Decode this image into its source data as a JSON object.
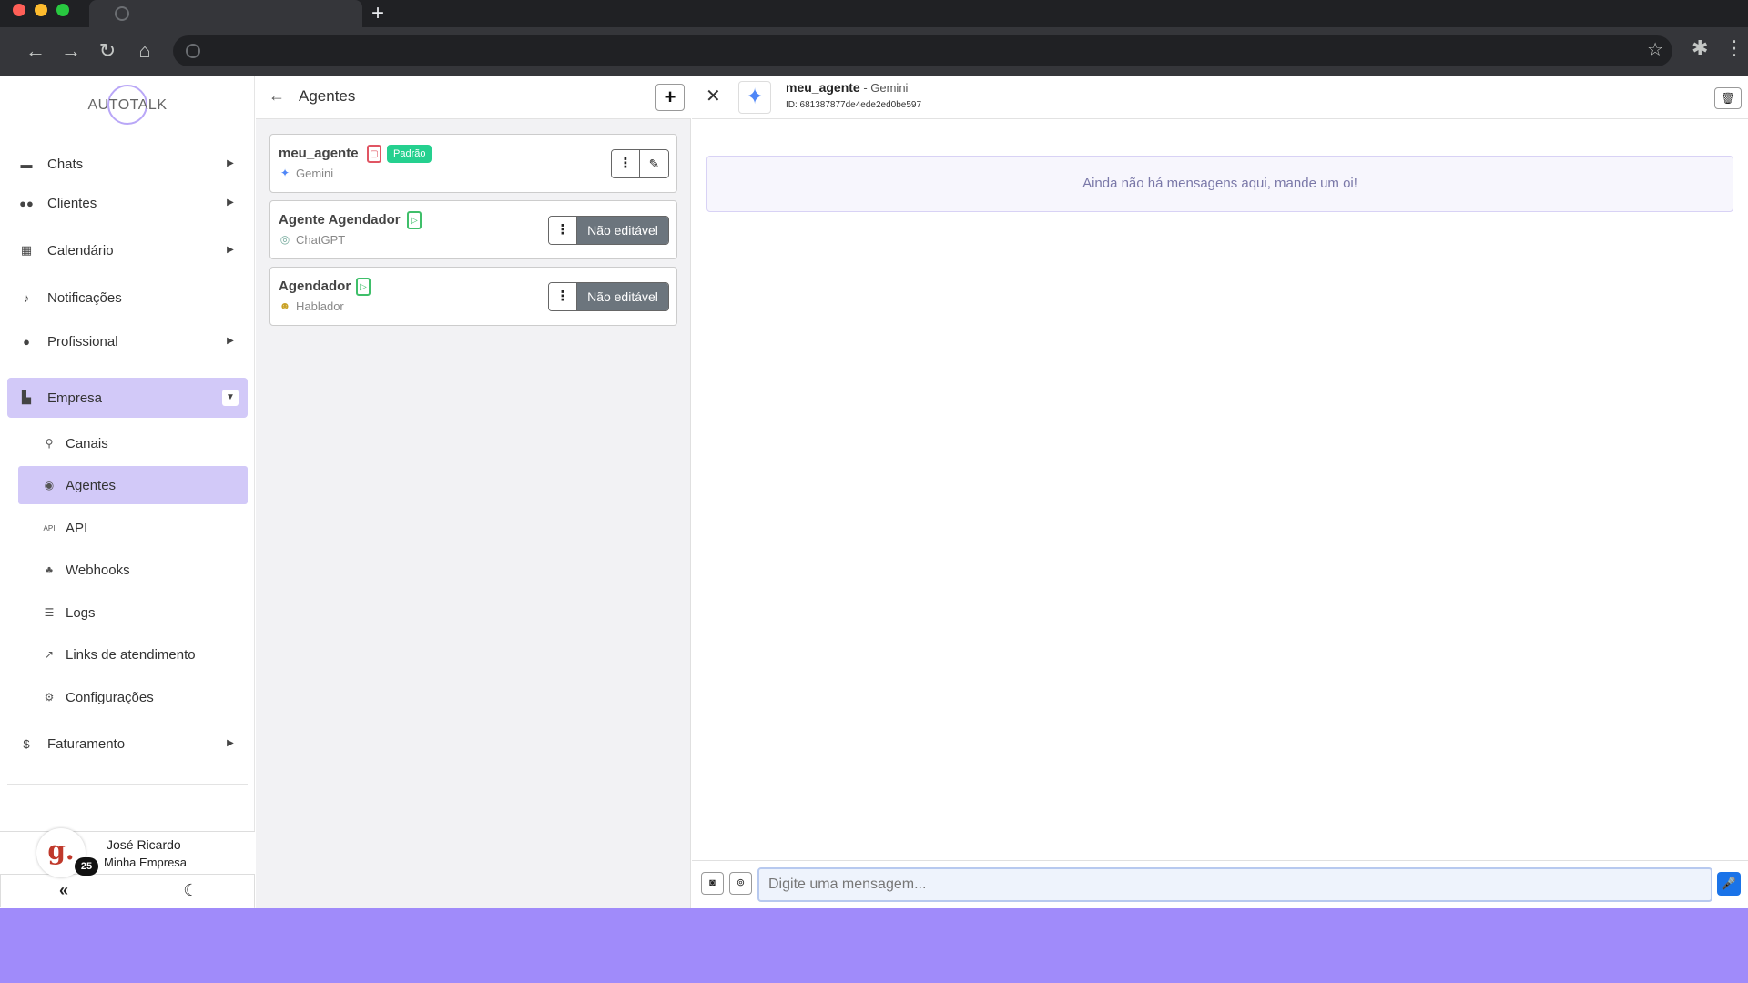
{
  "browser": {
    "new_tab_icon": "plus-icon",
    "nav_icons": [
      "back-arrow-icon",
      "forward-arrow-icon",
      "reload-icon",
      "home-icon"
    ]
  },
  "sidebar": {
    "logo_text": "AUTOTALK",
    "items": [
      {
        "label": "Chats",
        "icon": "comment-icon"
      },
      {
        "label": "Clientes",
        "icon": "users-icon"
      },
      {
        "label": "Calendário",
        "icon": "calendar-icon"
      },
      {
        "label": "Notificações",
        "icon": "bell-icon"
      },
      {
        "label": "Profissional",
        "icon": "user-gear-icon"
      },
      {
        "label": "Empresa",
        "icon": "building-icon"
      },
      {
        "label": "Faturamento",
        "icon": "dollar-icon"
      }
    ],
    "sub_items": [
      {
        "label": "Canais",
        "icon": "satellite-icon"
      },
      {
        "label": "Agentes",
        "icon": "robot-icon"
      },
      {
        "label": "API",
        "icon": "api-icon"
      },
      {
        "label": "Webhooks",
        "icon": "webhook-icon"
      },
      {
        "label": "Logs",
        "icon": "list-icon"
      },
      {
        "label": "Links de atendimento",
        "icon": "external-link-icon"
      },
      {
        "label": "Configurações",
        "icon": "gear-icon"
      }
    ],
    "user": {
      "name": "José Ricardo",
      "company": "Minha Empresa",
      "avatar_letter": "g.",
      "badge_count": "25"
    }
  },
  "agents": {
    "title": "Agentes",
    "list": [
      {
        "name": "meu_agente",
        "provider": "Gemini",
        "tag": "Padrão",
        "action": "Editar"
      },
      {
        "name": "Agente Agendador",
        "provider": "ChatGPT",
        "action": "Não editável"
      },
      {
        "name": "Agendador",
        "provider": "Hablador",
        "action": "Não editável"
      }
    ]
  },
  "chat": {
    "agent_name": "meu_agente",
    "provider_suffix": " - Gemini",
    "agent_id": "ID: 681387877de4ede2ed0be597",
    "empty_message": "Ainda não há mensagens aqui, mande um oi!",
    "input_placeholder": "Digite uma mensagem..."
  },
  "colors": {
    "accent": "#d2c9f8",
    "background": "#a08bfa",
    "default_tag": "#25d08f",
    "mic_button": "#1a73e8"
  }
}
